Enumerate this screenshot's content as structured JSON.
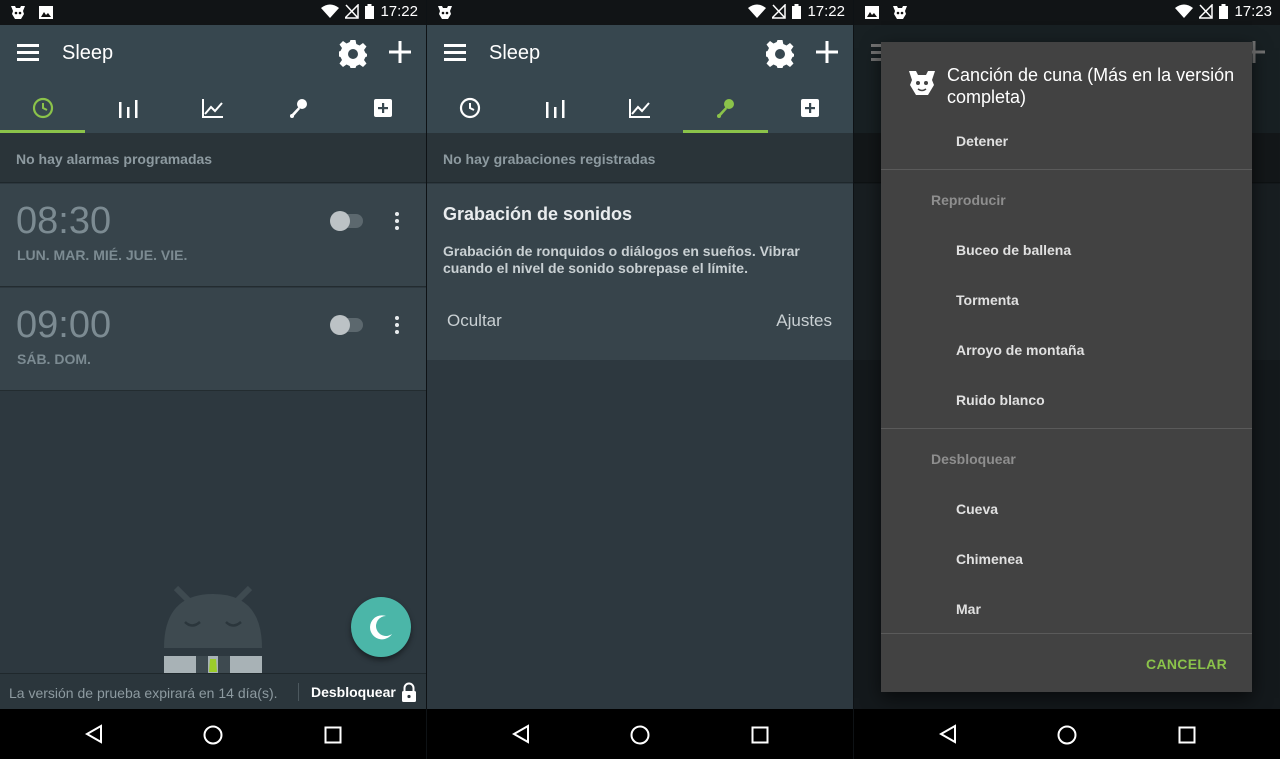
{
  "status": {
    "p1_time": "17:22",
    "p2_time": "17:22",
    "p3_time": "17:23"
  },
  "app": {
    "title": "Sleep"
  },
  "panel1": {
    "info": "No hay alarmas programadas",
    "alarms": [
      {
        "time": "08:30",
        "days": "LUN. MAR. MIÉ. JUE. VIE.",
        "enabled": false
      },
      {
        "time": "09:00",
        "days": "SÁB. DOM.",
        "enabled": false
      }
    ],
    "trial_message": "La versión de prueba expirará en 14 día(s).",
    "unlock_label": "Desbloquear"
  },
  "panel2": {
    "info": "No hay grabaciones registradas",
    "card_title": "Grabación de sonidos",
    "card_description": "Grabación de ronquidos o diálogos en sueños. Vibrar cuando el nivel de sonido sobrepase el límite.",
    "hide_label": "Ocultar",
    "settings_label": "Ajustes"
  },
  "panel3": {
    "dialog_title": "Canción de cuna (Más en la versión completa)",
    "stop_label": "Detener",
    "play_header": "Reproducir",
    "play_items": [
      "Buceo de ballena",
      "Tormenta",
      "Arroyo de montaña",
      "Ruido blanco"
    ],
    "unlock_header": "Desbloquear",
    "locked_items": [
      "Cueva",
      "Chimenea",
      "Mar"
    ],
    "cancel_label": "CANCELAR"
  },
  "colors": {
    "accent": "#8bc34a",
    "fab": "#4bb6a8",
    "toolbar": "#37474f",
    "background": "#2d383f"
  },
  "icons": {
    "tabs": [
      "clock-icon",
      "bars-icon",
      "trend-icon",
      "microphone-icon",
      "add-box-icon"
    ]
  }
}
